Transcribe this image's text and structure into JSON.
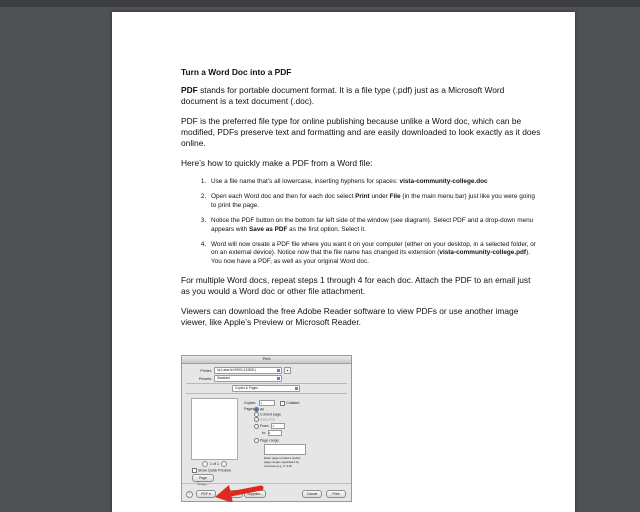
{
  "document": {
    "title": "Turn a Word Doc into a PDF",
    "para1_bold": "PDF",
    "para1_rest": " stands for portable document format. It is a file type (.pdf) just as a Microsoft Word document is a text document (.doc).",
    "para2": "PDF is the preferred file type for online publishing because unlike a Word doc, which can be modified, PDFs preserve text and formatting and are easily downloaded to look exactly as it does online.",
    "para3": "Here’s how to quickly make a PDF from a Word file:",
    "steps": [
      {
        "t1": "Use a file name that’s all lowercase, inserting hyphens for spaces: ",
        "b1": "vista-community-college.doc"
      },
      {
        "t1": "Open each Word doc and then for each doc select ",
        "b1": "Print",
        "t2": " under ",
        "b2": "File",
        "t3": " (in the main menu bar) just like you were going to print the page."
      },
      {
        "t1": "Notice the PDF button on the bottom far left side of the window (see diagram). Select PDF and a drop-down menu appears with ",
        "b1": "Save as PDF",
        "t2": " as the first option. Select it."
      },
      {
        "t1": "Word will now create a PDF file where you want it on your computer (either on your desktop, in a selected folder, or on an external device). Notice now that  the file name has changed its extension (",
        "b1": "vista-community-college.pdf",
        "t2": "). You now have a PDF, as well as your original Word doc."
      }
    ],
    "para4": "For multiple Word docs, repeat steps 1 through 4 for each doc. Attach the PDF to an email just as you would a Word doc or other file attachment.",
    "para5": "Viewers can download the free Adobe Reader software to view PDFs or use another image viewer, like Apple’s Preview or Microsoft Reader."
  },
  "print_dialog": {
    "title": "Print",
    "printer_label": "Printer:",
    "printer_value": "hp LaserJet 9050 (143D81)",
    "presets_label": "Presets:",
    "presets_value": "Standard",
    "section_value": "Copies & Pages",
    "copies_label": "Copies:",
    "copies_value": "1",
    "collated_label": "Collated",
    "pages_label": "Pages:",
    "pages_all": "All",
    "pages_current": "Current page",
    "pages_selection": "Selection",
    "pages_from": "From:",
    "from_value": "1",
    "pages_to": "to:",
    "to_value": "1",
    "pages_range": "Page range:",
    "range_hint": "Enter page numbers and/or page ranges separated by commas (e.g. 2, 5-8)",
    "page_counter": "1 of 1",
    "show_quick_preview": "Show Quick Preview",
    "page_setup": "Page Setup...",
    "help": "?",
    "pdf_button": "PDF ▾",
    "preview_button": "Preview",
    "supplies_button": "Supplies...",
    "cancel_button": "Cancel",
    "print_button": "Print"
  },
  "colors": {
    "background": "#4f5154",
    "arrow": "#e0281f"
  }
}
